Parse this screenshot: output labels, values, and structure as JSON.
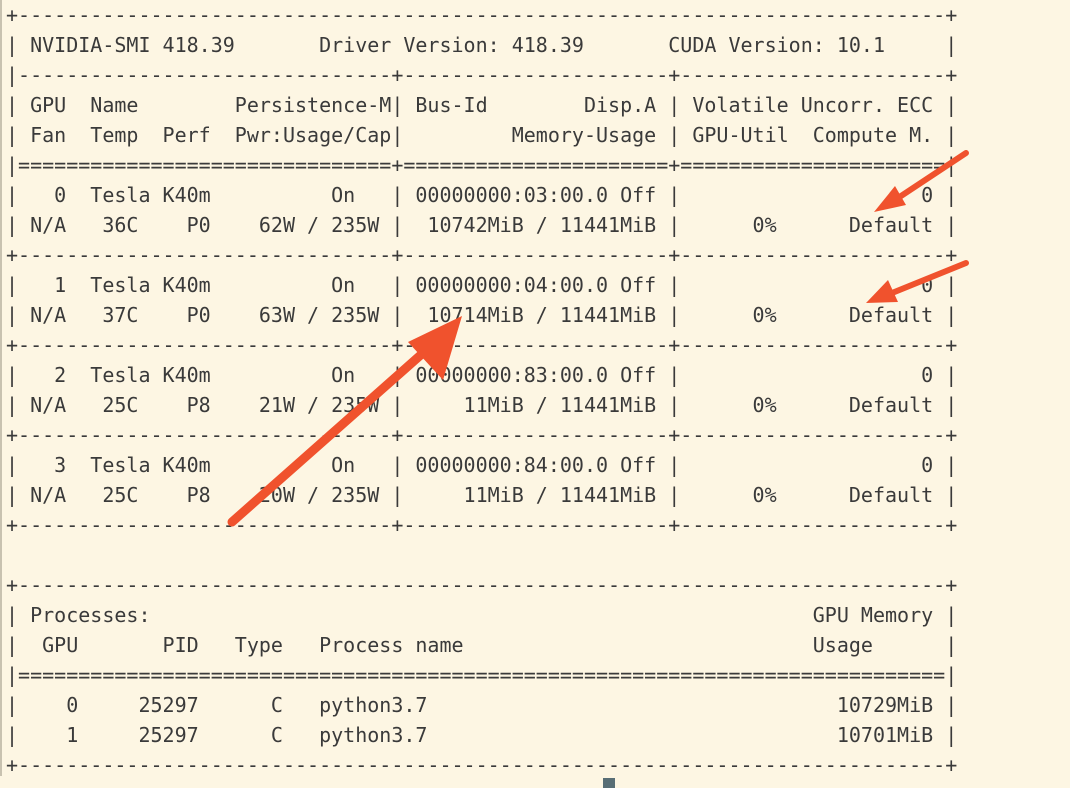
{
  "terminal": {
    "lines": [
      "+-----------------------------------------------------------------------------+",
      "| NVIDIA-SMI 418.39       Driver Version: 418.39       CUDA Version: 10.1     |",
      "|-------------------------------+----------------------+----------------------+",
      "| GPU  Name        Persistence-M| Bus-Id        Disp.A | Volatile Uncorr. ECC |",
      "| Fan  Temp  Perf  Pwr:Usage/Cap|         Memory-Usage | GPU-Util  Compute M. |",
      "|===============================+======================+======================|",
      "|   0  Tesla K40m          On   | 00000000:03:00.0 Off |                    0 |",
      "| N/A   36C    P0    62W / 235W |  10742MiB / 11441MiB |      0%      Default |",
      "+-------------------------------+----------------------+----------------------+",
      "|   1  Tesla K40m          On   | 00000000:04:00.0 Off |                    0 |",
      "| N/A   37C    P0    63W / 235W |  10714MiB / 11441MiB |      0%      Default |",
      "+-------------------------------+----------------------+----------------------+",
      "|   2  Tesla K40m          On   | 00000000:83:00.0 Off |                    0 |",
      "| N/A   25C    P8    21W / 235W |     11MiB / 11441MiB |      0%      Default |",
      "+-------------------------------+----------------------+----------------------+",
      "|   3  Tesla K40m          On   | 00000000:84:00.0 Off |                    0 |",
      "| N/A   25C    P8    20W / 235W |     11MiB / 11441MiB |      0%      Default |",
      "+-------------------------------+----------------------+----------------------+",
      "",
      "+-----------------------------------------------------------------------------+",
      "| Processes:                                                       GPU Memory |",
      "|  GPU       PID   Type   Process name                             Usage      |",
      "|=============================================================================|",
      "|    0     25297      C   python3.7                                  10729MiB |",
      "|    1     25297      C   python3.7                                  10701MiB |",
      "+-----------------------------------------------------------------------------+"
    ]
  },
  "colors": {
    "background": "#fdf6e3",
    "text": "#3a3a3a",
    "arrow": "#f0522d"
  }
}
